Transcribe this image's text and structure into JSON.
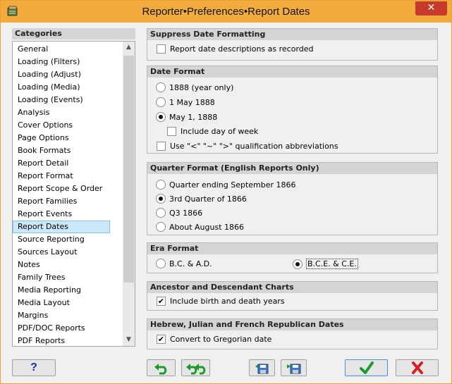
{
  "window": {
    "title": "Reporter•Preferences•Report Dates",
    "close_glyph": "✕"
  },
  "categories": {
    "header": "Categories",
    "items": [
      "General",
      "Loading (Filters)",
      "Loading (Adjust)",
      "Loading (Media)",
      "Loading (Events)",
      "Analysis",
      "Cover Options",
      "Page Options",
      "Book Formats",
      "Report Detail",
      "Report Format",
      "Report Scope & Order",
      "Report Families",
      "Report Events",
      "Report Dates",
      "Source Reporting",
      "Sources Layout",
      "Notes",
      "Family Trees",
      "Media Reporting",
      "Media Layout",
      "Margins",
      "PDF/DOC Reports",
      "PDF Reports"
    ],
    "selected": "Report Dates"
  },
  "suppress": {
    "header": "Suppress Date Formatting",
    "option": "Report date descriptions as recorded",
    "checked": false
  },
  "date_format": {
    "header": "Date Format",
    "options": [
      "1888 (year only)",
      "1 May 1888",
      "May 1, 1888"
    ],
    "selected": "May 1, 1888",
    "include_dow": "Include day of week",
    "include_dow_checked": false,
    "qualif": "Use \"<\" \"~\" \">\" qualification abbreviations",
    "qualif_checked": false
  },
  "quarter": {
    "header": "Quarter Format (English Reports Only)",
    "options": [
      "Quarter ending September 1866",
      "3rd Quarter of 1866",
      "Q3 1866",
      "About August 1866"
    ],
    "selected": "3rd Quarter of 1866"
  },
  "era": {
    "header": "Era Format",
    "options": [
      "B.C. &  A.D.",
      "B.C.E. & C.E."
    ],
    "selected": "B.C.E. & C.E."
  },
  "charts": {
    "header": "Ancestor and Descendant Charts",
    "option": "Include birth and death years",
    "checked": true
  },
  "hebrew": {
    "header": "Hebrew, Julian and French Republican Dates",
    "option": "Convert to Gregorian date",
    "checked": true
  },
  "buttons": {
    "help": "?",
    "ok_color": "#1e9a2c",
    "cancel_color": "#d42020",
    "help_color": "#1c2fa8"
  }
}
